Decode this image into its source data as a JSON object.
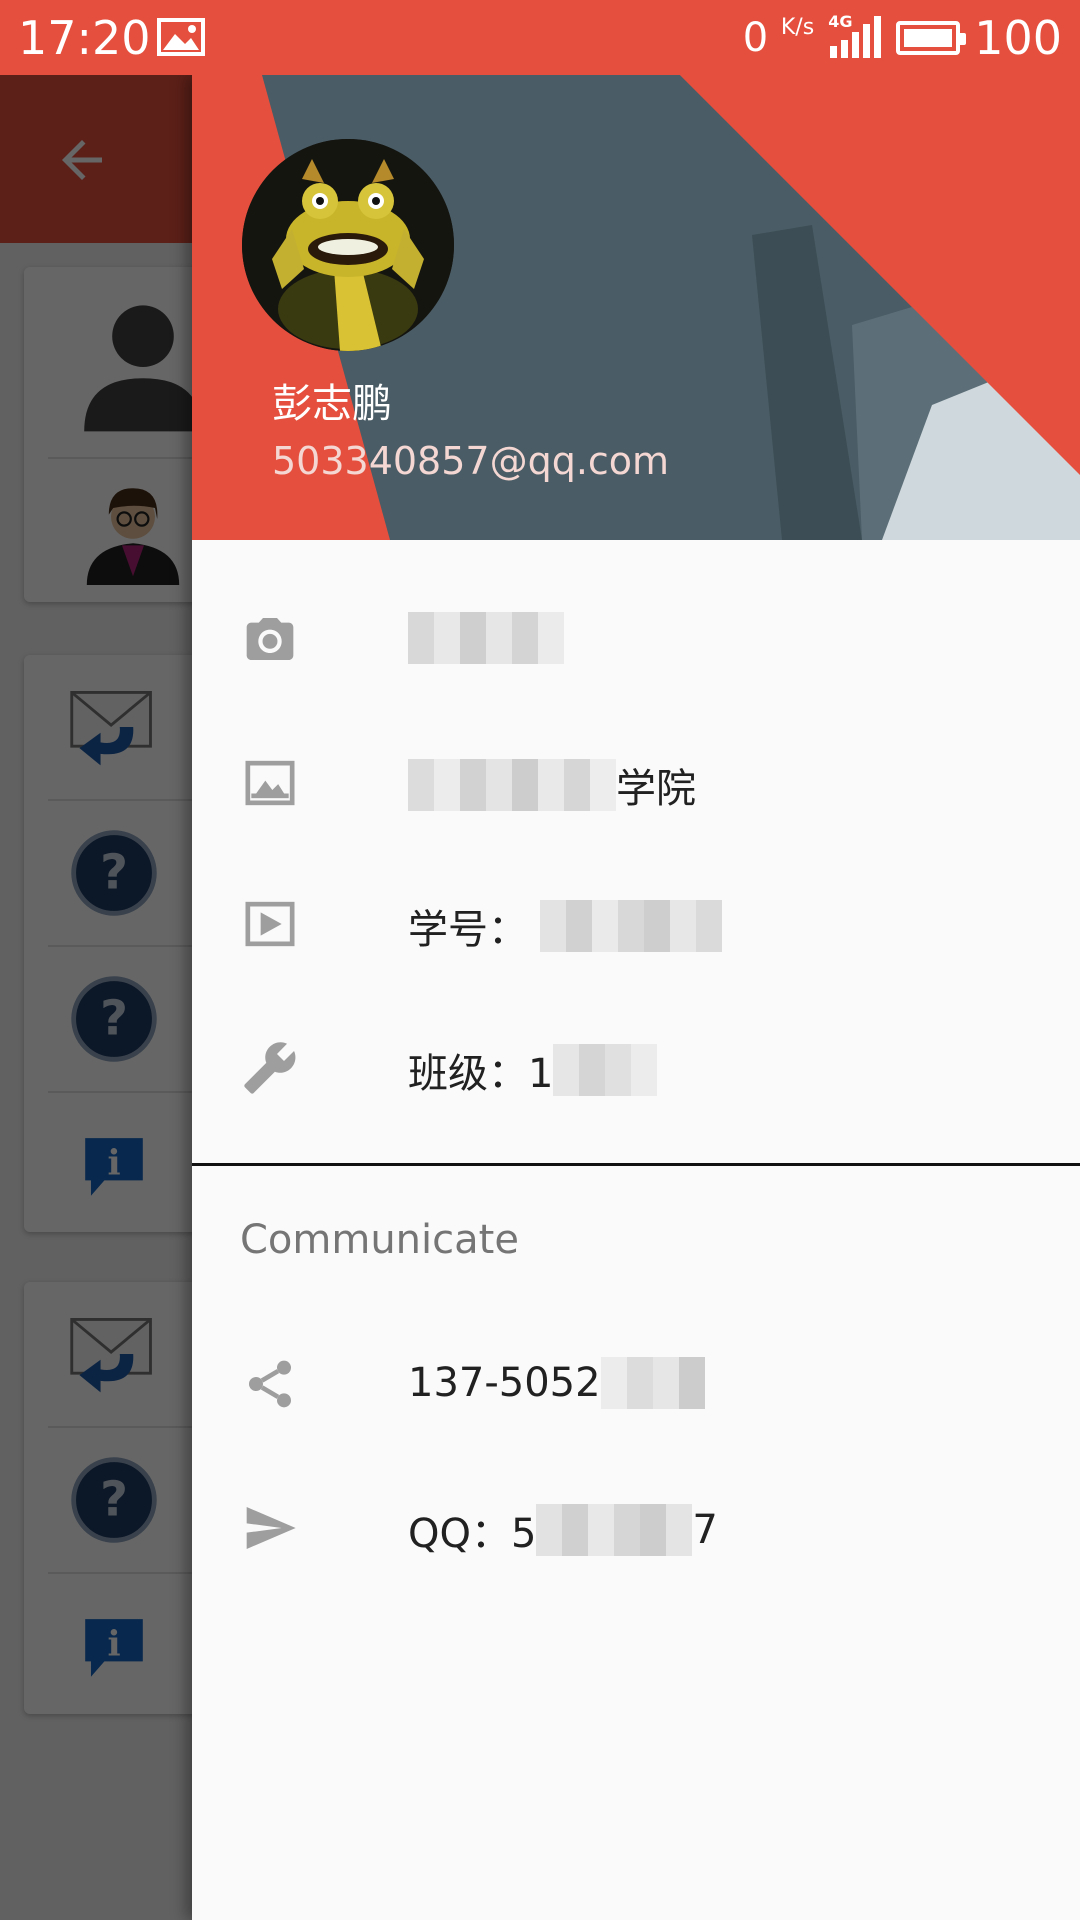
{
  "status_bar": {
    "time": "17:20",
    "speed_value": "0",
    "speed_unit": "K/s",
    "network": "4G",
    "battery": "100",
    "icons": [
      "image-icon",
      "signal-icon",
      "battery-icon"
    ]
  },
  "app": {
    "title": "",
    "back_icon": "arrow-back-icon",
    "toolbar_color": "#e5503e"
  },
  "drawer": {
    "header": {
      "name": "彭志鹏",
      "email": "503340857@qq.com",
      "colors": {
        "red": "#e5503e",
        "slate": "#455a64"
      }
    },
    "items": [
      {
        "icon": "camera-icon",
        "text": "",
        "redacted": true
      },
      {
        "icon": "image-icon",
        "text": "学院",
        "redacted_prefix": true
      },
      {
        "icon": "play-icon",
        "text": "学号：",
        "redacted_suffix": true
      },
      {
        "icon": "wrench-icon",
        "text": "班级：1",
        "redacted_suffix": true
      }
    ],
    "section_title": "Communicate",
    "communicate": [
      {
        "icon": "share-icon",
        "text": "137-5052",
        "redacted_suffix": true
      },
      {
        "icon": "send-icon",
        "text": "QQ：5",
        "text_end": "7",
        "redacted_middle": true
      }
    ]
  }
}
